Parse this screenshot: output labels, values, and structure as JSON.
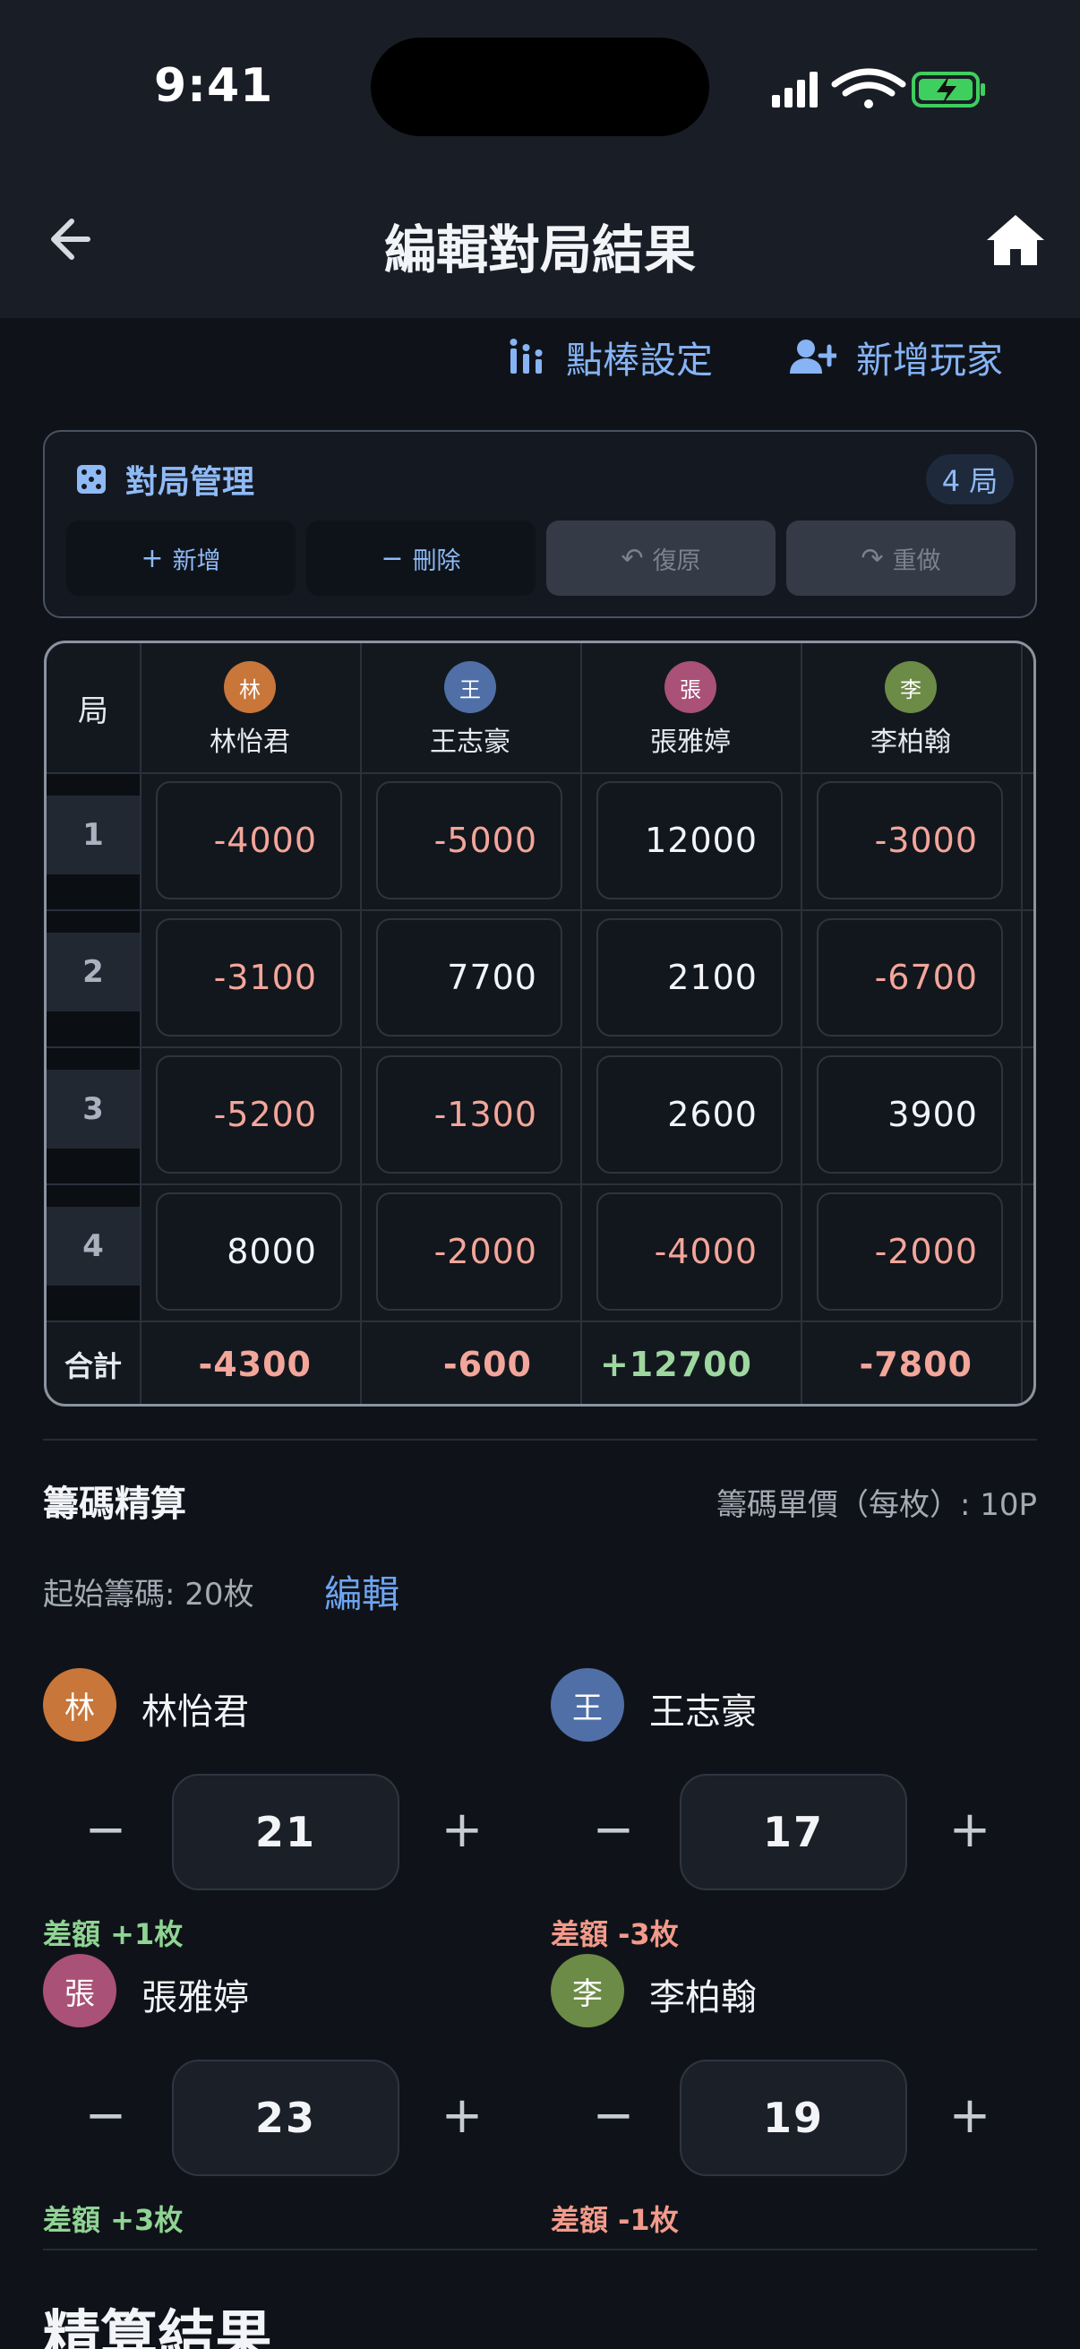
{
  "status": {
    "time": "9:41"
  },
  "nav": {
    "title": "編輯對局結果"
  },
  "actions": {
    "stick_settings": "點棒設定",
    "add_player": "新增玩家"
  },
  "game_panel": {
    "title": "對局管理",
    "count_badge": "4 局",
    "add": "新增",
    "delete": "刪除",
    "undo": "復原",
    "redo": "重做"
  },
  "table": {
    "round_header": "局",
    "total_label": "合計",
    "players": [
      {
        "initial": "林",
        "name": "林怡君",
        "color": "#c8763a"
      },
      {
        "initial": "王",
        "name": "王志豪",
        "color": "#4f6fa6"
      },
      {
        "initial": "張",
        "name": "張雅婷",
        "color": "#a95177"
      },
      {
        "initial": "李",
        "name": "李柏翰",
        "color": "#6c8b46"
      }
    ],
    "rounds": [
      {
        "no": "1",
        "scores": [
          "-4000",
          "-5000",
          "12000",
          "-3000"
        ]
      },
      {
        "no": "2",
        "scores": [
          "-3100",
          "7700",
          "2100",
          "-6700"
        ]
      },
      {
        "no": "3",
        "scores": [
          "-5200",
          "-1300",
          "2600",
          "3900"
        ]
      },
      {
        "no": "4",
        "scores": [
          "8000",
          "-2000",
          "-4000",
          "-2000"
        ]
      }
    ],
    "totals": [
      "-4300",
      "-600",
      "+12700",
      "-7800"
    ]
  },
  "chips": {
    "title": "籌碼精算",
    "unit_price": "籌碼單價（每枚）: 10P",
    "start_label": "起始籌碼: 20枚",
    "edit": "編輯",
    "players": [
      {
        "initial": "林",
        "name": "林怡君",
        "count": "21",
        "diff": "差額 +1枚",
        "color": "#c8763a"
      },
      {
        "initial": "王",
        "name": "王志豪",
        "count": "17",
        "diff": "差額 -3枚",
        "color": "#4f6fa6"
      },
      {
        "initial": "張",
        "name": "張雅婷",
        "count": "23",
        "diff": "差額 +3枚",
        "color": "#a95177"
      },
      {
        "initial": "李",
        "name": "李柏翰",
        "count": "19",
        "diff": "差額 -1枚",
        "color": "#6c8b46"
      }
    ]
  },
  "result": {
    "title": "精算結果"
  }
}
